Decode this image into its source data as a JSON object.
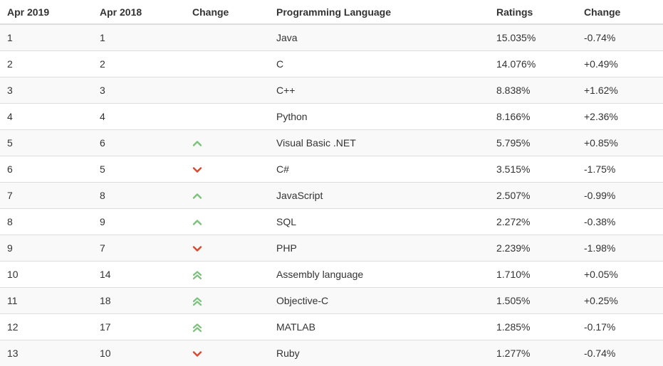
{
  "columns": {
    "rank_current": "Apr 2019",
    "rank_previous": "Apr 2018",
    "change_icon": "Change",
    "language": "Programming Language",
    "ratings": "Ratings",
    "change_value": "Change"
  },
  "colors": {
    "up": "#7cc17c",
    "down": "#d9482b",
    "row_alt": "#f9f9f9",
    "border": "#dddddd"
  },
  "rows": [
    {
      "rank": "1",
      "prev": "1",
      "icon": "none",
      "lang": "Java",
      "rating": "15.035%",
      "change": "-0.74%"
    },
    {
      "rank": "2",
      "prev": "2",
      "icon": "none",
      "lang": "C",
      "rating": "14.076%",
      "change": "+0.49%"
    },
    {
      "rank": "3",
      "prev": "3",
      "icon": "none",
      "lang": "C++",
      "rating": "8.838%",
      "change": "+1.62%"
    },
    {
      "rank": "4",
      "prev": "4",
      "icon": "none",
      "lang": "Python",
      "rating": "8.166%",
      "change": "+2.36%"
    },
    {
      "rank": "5",
      "prev": "6",
      "icon": "up",
      "lang": "Visual Basic .NET",
      "rating": "5.795%",
      "change": "+0.85%"
    },
    {
      "rank": "6",
      "prev": "5",
      "icon": "down",
      "lang": "C#",
      "rating": "3.515%",
      "change": "-1.75%"
    },
    {
      "rank": "7",
      "prev": "8",
      "icon": "up",
      "lang": "JavaScript",
      "rating": "2.507%",
      "change": "-0.99%"
    },
    {
      "rank": "8",
      "prev": "9",
      "icon": "up",
      "lang": "SQL",
      "rating": "2.272%",
      "change": "-0.38%"
    },
    {
      "rank": "9",
      "prev": "7",
      "icon": "down",
      "lang": "PHP",
      "rating": "2.239%",
      "change": "-1.98%"
    },
    {
      "rank": "10",
      "prev": "14",
      "icon": "double-up",
      "lang": "Assembly language",
      "rating": "1.710%",
      "change": "+0.05%"
    },
    {
      "rank": "11",
      "prev": "18",
      "icon": "double-up",
      "lang": "Objective-C",
      "rating": "1.505%",
      "change": "+0.25%"
    },
    {
      "rank": "12",
      "prev": "17",
      "icon": "double-up",
      "lang": "MATLAB",
      "rating": "1.285%",
      "change": "-0.17%"
    },
    {
      "rank": "13",
      "prev": "10",
      "icon": "down",
      "lang": "Ruby",
      "rating": "1.277%",
      "change": "-0.74%"
    }
  ]
}
